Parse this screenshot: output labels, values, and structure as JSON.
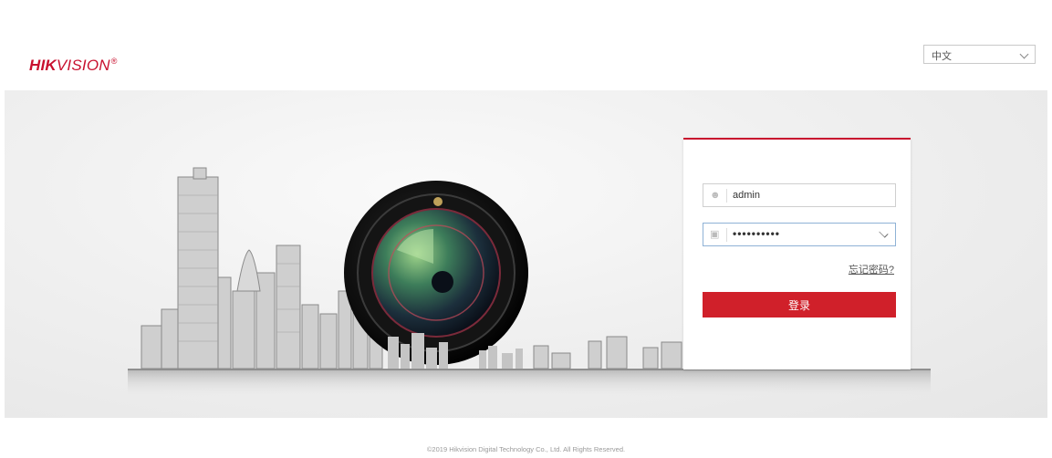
{
  "brand": {
    "strong": "HIK",
    "rest": "VISION",
    "reg": "®"
  },
  "language": {
    "selected": "中文"
  },
  "login": {
    "username": "admin",
    "password_mask": "••••••••••",
    "forgot_label": "忘记密码?",
    "submit_label": "登录"
  },
  "footer": {
    "copyright": "©2019 Hikvision Digital Technology Co., Ltd. All Rights Reserved."
  },
  "colors": {
    "accent": "#c8102e",
    "button": "#d0202a"
  },
  "icons": {
    "username": "user-icon",
    "password": "lock-icon",
    "password_toggle": "chevron-down-icon",
    "language": "chevron-down-icon"
  }
}
